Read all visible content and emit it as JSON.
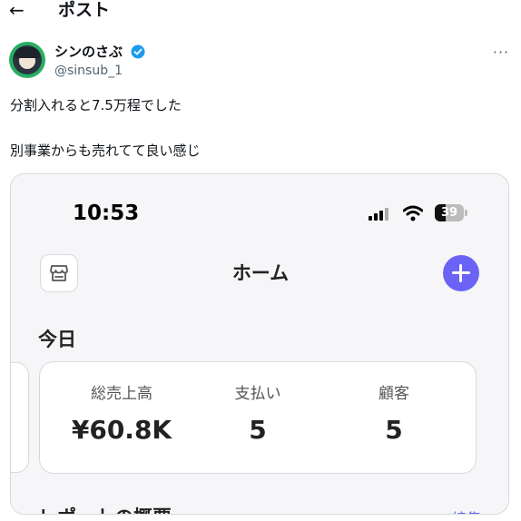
{
  "header": {
    "back_icon": "←",
    "title": "ポスト"
  },
  "author": {
    "display_name": "シンのさぶ",
    "handle": "@sinsub_1",
    "verified_color": "#1d9bf0",
    "more_icon": "···"
  },
  "post": {
    "line1": "分割入れると7.5万程でした",
    "line2": "別事業からも売れてて良い感じ"
  },
  "screenshot": {
    "status_bar": {
      "time": "10:53",
      "battery_level": "39",
      "battery_fraction": 0.39
    },
    "app": {
      "title": "ホーム",
      "accent_color": "#6b63f5",
      "today_heading": "今日",
      "stats": [
        {
          "label": "総売上高",
          "value": "¥60.8K"
        },
        {
          "label": "支払い",
          "value": "5"
        },
        {
          "label": "顧客",
          "value": "5"
        }
      ],
      "report_heading": "レポートの概要",
      "report_link": "編集"
    }
  }
}
